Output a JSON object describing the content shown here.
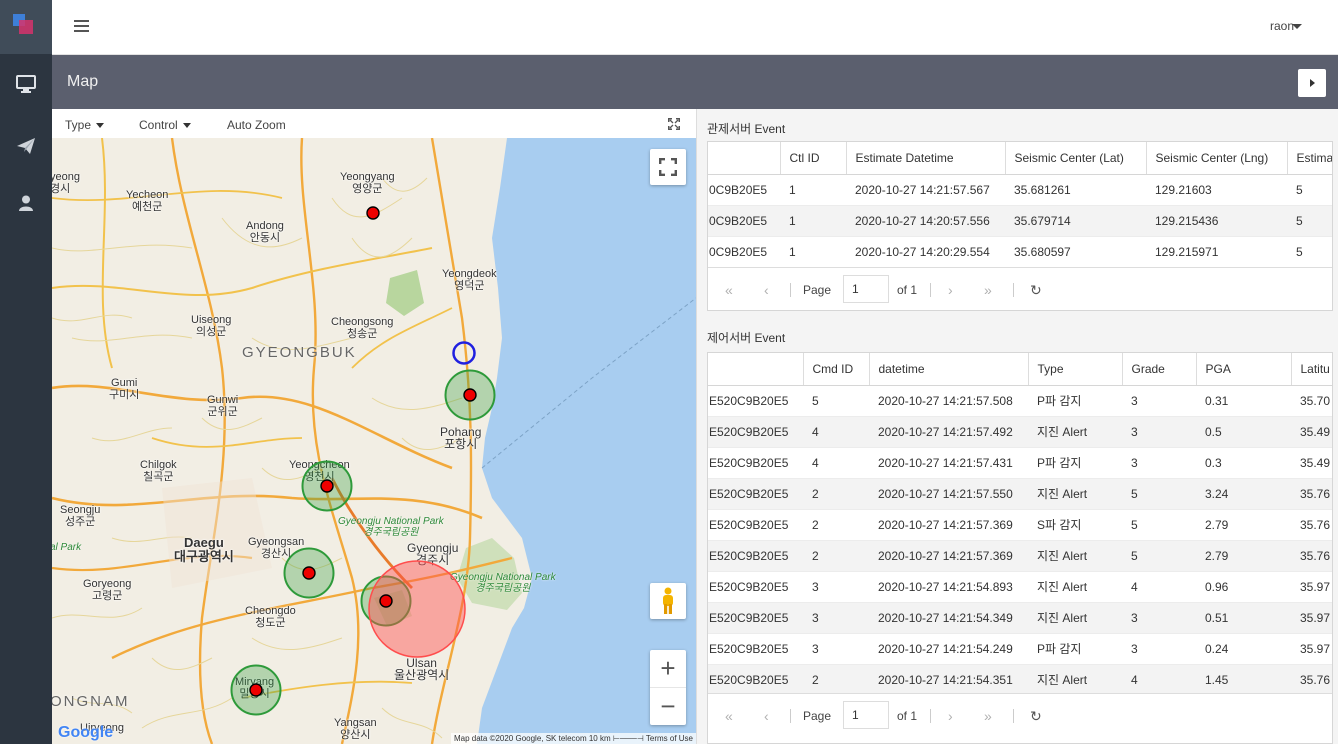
{
  "topbar": {
    "user": "raon"
  },
  "band": {
    "title": "Map"
  },
  "map": {
    "toolbar": {
      "type_label": "Type",
      "control_label": "Control",
      "autozoom_label": "Auto Zoom"
    },
    "places": [
      {
        "en": "Yeongyang",
        "ko": "영양군"
      },
      {
        "en": "Yecheon",
        "ko": "예천군"
      },
      {
        "en": "Andong",
        "ko": "안동시"
      },
      {
        "en": "Yeongdeok",
        "ko": "영덕군"
      },
      {
        "en": "Uiseong",
        "ko": "의성군"
      },
      {
        "en": "Cheongsong",
        "ko": "청송군"
      },
      {
        "en": "Gumi",
        "ko": "구미시"
      },
      {
        "en": "Gunwi",
        "ko": "군위군"
      },
      {
        "en": "Pohang",
        "ko": "포항시"
      },
      {
        "en": "Chilgok",
        "ko": "칠곡군"
      },
      {
        "en": "Yeongcheon",
        "ko": "영천시"
      },
      {
        "en": "Seongju",
        "ko": "성주군"
      },
      {
        "en": "Daegu",
        "ko": "대구광역시"
      },
      {
        "en": "Gyeongsan",
        "ko": "경산시"
      },
      {
        "en": "Gyeongju",
        "ko": "경주시"
      },
      {
        "en": "Goryeong",
        "ko": "고령군"
      },
      {
        "en": "Cheongdo",
        "ko": "청도군"
      },
      {
        "en": "Ulsan",
        "ko": "울산광역시"
      },
      {
        "en": "Miryang",
        "ko": "밀양시"
      },
      {
        "en": "Yangsan",
        "ko": "양산시"
      },
      {
        "en": "Uiryeong",
        "ko": ""
      },
      {
        "en": "yeong",
        "ko": "경시"
      }
    ],
    "regions": [
      "GYEONGBUK",
      "ONGNAM"
    ],
    "parks": [
      {
        "en": "Gyeongju National Park",
        "ko": "경주국립공원"
      },
      {
        "en": "Gyeongju National Park",
        "ko": "경주국립공원"
      },
      {
        "en": "al Park",
        "ko": ""
      }
    ],
    "google_logo": "Google",
    "attribution": "Map data ©2020 Google, SK telecom    10 km ⊢───⊣    Terms of Use",
    "icons": [
      "fullscreen-icon",
      "pegman-icon",
      "zoom-in-icon",
      "zoom-out-icon",
      "expand-icon"
    ],
    "zoom_in": "+",
    "zoom_out": "−"
  },
  "ctl_section": {
    "title": "관제서버 Event",
    "columns": [
      "",
      "Ctl ID",
      "Estimate Datetime",
      "Seismic Center (Lat)",
      "Seismic Center (Lng)",
      "Estima"
    ],
    "rows": [
      [
        "0C9B20E5",
        "1",
        "2020-10-27 14:21:57.567",
        "35.681261",
        "129.21603",
        "5"
      ],
      [
        "0C9B20E5",
        "1",
        "2020-10-27 14:20:57.556",
        "35.679714",
        "129.215436",
        "5"
      ],
      [
        "0C9B20E5",
        "1",
        "2020-10-27 14:20:29.554",
        "35.680597",
        "129.215971",
        "5"
      ]
    ],
    "pager": {
      "page_label": "Page",
      "page_value": "1",
      "of_label": "of 1"
    }
  },
  "cmd_section": {
    "title": "제어서버 Event",
    "columns": [
      "",
      "Cmd ID",
      "datetime",
      "Type",
      "Grade",
      "PGA",
      "Latitu"
    ],
    "rows": [
      [
        "E520C9B20E5",
        "5",
        "2020-10-27 14:21:57.508",
        "P파 감지",
        "3",
        "0.31",
        "35.70"
      ],
      [
        "E520C9B20E5",
        "4",
        "2020-10-27 14:21:57.492",
        "지진 Alert",
        "3",
        "0.5",
        "35.49"
      ],
      [
        "E520C9B20E5",
        "4",
        "2020-10-27 14:21:57.431",
        "P파 감지",
        "3",
        "0.3",
        "35.49"
      ],
      [
        "E520C9B20E5",
        "2",
        "2020-10-27 14:21:57.550",
        "지진 Alert",
        "5",
        "3.24",
        "35.76"
      ],
      [
        "E520C9B20E5",
        "2",
        "2020-10-27 14:21:57.369",
        "S파 감지",
        "5",
        "2.79",
        "35.76"
      ],
      [
        "E520C9B20E5",
        "2",
        "2020-10-27 14:21:57.369",
        "지진 Alert",
        "5",
        "2.79",
        "35.76"
      ],
      [
        "E520C9B20E5",
        "3",
        "2020-10-27 14:21:54.893",
        "지진 Alert",
        "4",
        "0.96",
        "35.97"
      ],
      [
        "E520C9B20E5",
        "3",
        "2020-10-27 14:21:54.349",
        "지진 Alert",
        "3",
        "0.51",
        "35.97"
      ],
      [
        "E520C9B20E5",
        "3",
        "2020-10-27 14:21:54.249",
        "P파 감지",
        "3",
        "0.24",
        "35.97"
      ],
      [
        "E520C9B20E5",
        "2",
        "2020-10-27 14:21:54.351",
        "지진 Alert",
        "4",
        "1.45",
        "35.76"
      ]
    ],
    "pager": {
      "page_label": "Page",
      "page_value": "1",
      "of_label": "of 1"
    }
  },
  "colors": {
    "sidebar": "#2c3540",
    "band": "#5b5f6e",
    "sea": "#a8cdf0",
    "alert_red": "#ff4d4d",
    "station_green": "#2e9a3a"
  },
  "sidebar_icons": [
    "monitor-icon",
    "paper-plane-icon",
    "user-icon"
  ],
  "pager_icons": [
    "first-page-icon",
    "prev-page-icon",
    "next-page-icon",
    "last-page-icon",
    "refresh-icon"
  ]
}
